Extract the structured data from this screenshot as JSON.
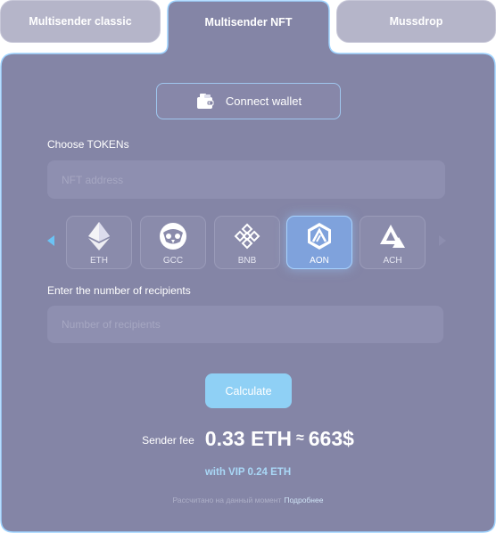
{
  "tabs": {
    "classic": "Multisender classic",
    "nft": "Multisender NFT",
    "mussdrop": "Mussdrop"
  },
  "connect": {
    "label": "Connect wallet",
    "icon": "wallet-icon"
  },
  "tokens_section": {
    "label": "Choose TOKENs",
    "placeholder": "NFT address"
  },
  "tokens": [
    {
      "label": "ETH",
      "icon": "ethereum-icon",
      "selected": false
    },
    {
      "label": "GCC",
      "icon": "owl-icon",
      "selected": false
    },
    {
      "label": "BNB",
      "icon": "bnb-icon",
      "selected": false
    },
    {
      "label": "AON",
      "icon": "aon-icon",
      "selected": true
    },
    {
      "label": "ACH",
      "icon": "ach-icon",
      "selected": false
    }
  ],
  "recipients": {
    "label": "Enter the number of recipients",
    "placeholder": "Number of recipients"
  },
  "calculate_label": "Calculate",
  "fee": {
    "label": "Sender fee",
    "eth": "0.33 ETH",
    "approx": "≈",
    "usd": "663$"
  },
  "vip": "with VIP 0.24 ETH",
  "footer": {
    "text": "Рассчитано на данный момент",
    "link": "Подробнее"
  },
  "colors": {
    "panel": "#8485a6",
    "border": "#9ed3ff",
    "accent": "#8fd0f5"
  }
}
